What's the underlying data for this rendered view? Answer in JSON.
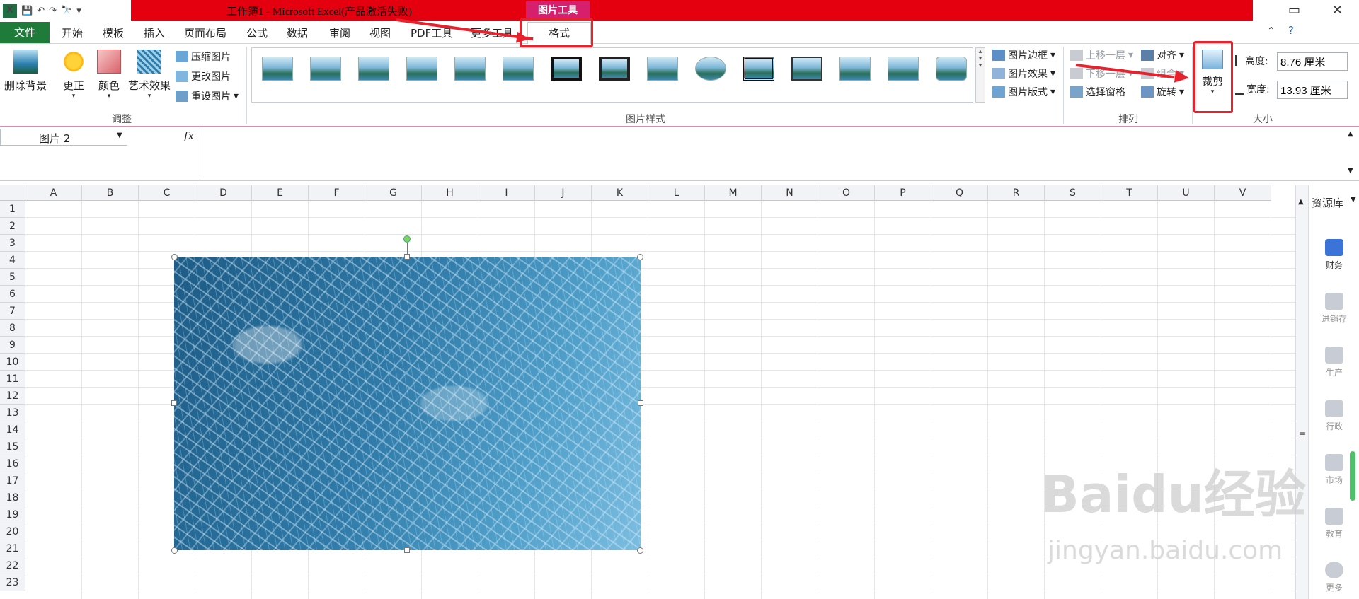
{
  "window": {
    "title": "工作簿1 - Microsoft Excel(产品激活失败)",
    "contextual_tab_group": "图片工具",
    "controls": [
      "▭",
      "✕"
    ]
  },
  "tabs": {
    "file": "文件",
    "items": [
      "开始",
      "模板",
      "插入",
      "页面布局",
      "公式",
      "数据",
      "审阅",
      "视图",
      "PDF工具",
      "更多工具"
    ],
    "active": "格式"
  },
  "ribbon": {
    "adjust": {
      "label": "调整",
      "remove_bg": "删除背景",
      "correct": "更正",
      "color": "颜色",
      "artistic": "艺术效果",
      "compress": "压缩图片",
      "change": "更改图片",
      "reset": "重设图片"
    },
    "styles": {
      "label": "图片样式",
      "border": "图片边框",
      "effects": "图片效果",
      "layout": "图片版式"
    },
    "arrange": {
      "label": "排列",
      "bring_forward": "上移一层",
      "send_backward": "下移一层",
      "selection_pane": "选择窗格",
      "align": "对齐",
      "group": "组合",
      "rotate": "旋转"
    },
    "size": {
      "label": "大小",
      "crop": "裁剪",
      "height_label": "高度:",
      "height_value": "8.76 厘米",
      "width_label": "宽度:",
      "width_value": "13.93 厘米"
    }
  },
  "formula_bar": {
    "name_box": "图片 2",
    "fx": "fx",
    "content": ""
  },
  "sheet": {
    "columns": [
      "A",
      "B",
      "C",
      "D",
      "E",
      "F",
      "G",
      "H",
      "I",
      "J",
      "K",
      "L",
      "M",
      "N",
      "O",
      "P",
      "Q",
      "R",
      "S",
      "T",
      "U",
      "V"
    ],
    "rows": [
      "1",
      "2",
      "3",
      "4",
      "5",
      "6",
      "7",
      "8",
      "9",
      "10",
      "11",
      "12",
      "13",
      "14",
      "15",
      "16",
      "17",
      "18",
      "19",
      "20",
      "21",
      "22",
      "23"
    ]
  },
  "side_panel": {
    "title": "资源库",
    "items": [
      "财务",
      "进销存",
      "生产",
      "行政",
      "市场",
      "教育",
      "更多"
    ]
  },
  "watermark": {
    "main": "Baidu经验",
    "sub": "jingyan.baidu.com"
  }
}
